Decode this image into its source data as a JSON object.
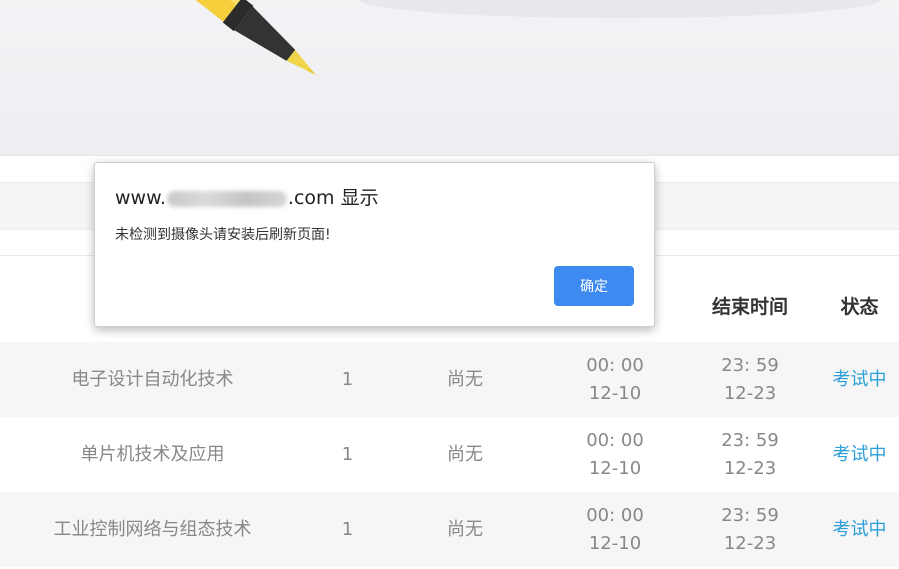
{
  "dialog": {
    "title_prefix": "www.",
    "title_suffix": ".com 显示",
    "message": "未检测到摄像头请安装后刷新页面!",
    "ok_label": "确定"
  },
  "table": {
    "headers": {
      "end_time": "结束时间",
      "status": "状态"
    },
    "rows": [
      {
        "name": "电子设计自动化技术",
        "count": "1",
        "score": "尚无",
        "start_time": "00: 00",
        "start_date": "12-10",
        "end_time": "23: 59",
        "end_date": "12-23",
        "status": "考试中"
      },
      {
        "name": "单片机技术及应用",
        "count": "1",
        "score": "尚无",
        "start_time": "00: 00",
        "start_date": "12-10",
        "end_time": "23: 59",
        "end_date": "12-23",
        "status": "考试中"
      },
      {
        "name": "工业控制网络与组态技术",
        "count": "1",
        "score": "尚无",
        "start_time": "00: 00",
        "start_date": "12-10",
        "end_time": "23: 59",
        "end_date": "12-23",
        "status": "考试中"
      }
    ]
  },
  "colors": {
    "accent": "#3d8af0",
    "status_link": "#2a9fd8",
    "pen_body": "#f5cf3c"
  }
}
